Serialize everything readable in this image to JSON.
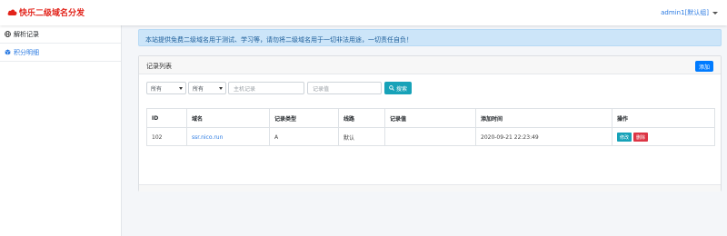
{
  "brand": {
    "title": "快乐二级域名分发",
    "color": "#e2231a"
  },
  "user": {
    "label": "admin1[默认组]"
  },
  "sidebar": {
    "items": [
      {
        "label": "解析记录",
        "icon": "globe-icon"
      },
      {
        "label": "积分明细",
        "icon": "cube-icon"
      }
    ]
  },
  "notice": {
    "text": "本站提供免费二级域名用于测试、学习等，请勿将二级域名用于一切非法用途，一切责任自负！"
  },
  "panel": {
    "title": "记录列表",
    "add_label": "添加"
  },
  "filters": {
    "select1": "所有",
    "select2": "所有",
    "host_placeholder": "主机记录",
    "value_placeholder": "记录值",
    "search_label": "搜索"
  },
  "table": {
    "headers": [
      "ID",
      "域名",
      "记录类型",
      "线路",
      "记录值",
      "添加时间",
      "操作"
    ],
    "rows": [
      {
        "id": "102",
        "domain": "ssr.nico.run",
        "type": "A",
        "line": "默认",
        "value": "",
        "time": "2020-09-21 22:23:49",
        "edit": "修改",
        "delete": "删除"
      }
    ]
  },
  "colors": {
    "primary": "#007bff",
    "info": "#17a2b8",
    "danger": "#dc3545",
    "alert_bg": "#cce5f9"
  }
}
